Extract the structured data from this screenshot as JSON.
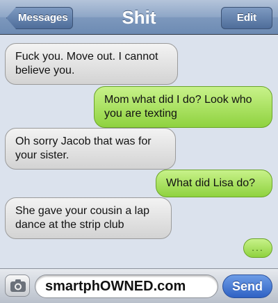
{
  "navbar": {
    "title": "Shit",
    "back_label": "Messages",
    "edit_label": "Edit"
  },
  "messages": [
    {
      "direction": "incoming",
      "text": "Fuck you. Move out. I cannot believe you."
    },
    {
      "direction": "outgoing",
      "text": "Mom what did I do? Look who you are texting"
    },
    {
      "direction": "incoming",
      "text": "Oh sorry Jacob that was for your sister."
    },
    {
      "direction": "outgoing",
      "text": "What did Lisa do?"
    },
    {
      "direction": "incoming",
      "text": "She gave your cousin a lap dance at the strip club"
    }
  ],
  "typing_indicator": "...",
  "input": {
    "camera_icon": "camera-icon",
    "value": "smartphOWNED.com",
    "send_label": "Send"
  },
  "colors": {
    "incoming_bubble": "#e3e3e3",
    "outgoing_bubble": "#a8e05e",
    "send_button": "#3f73d2",
    "navbar": "#7f99bd"
  }
}
